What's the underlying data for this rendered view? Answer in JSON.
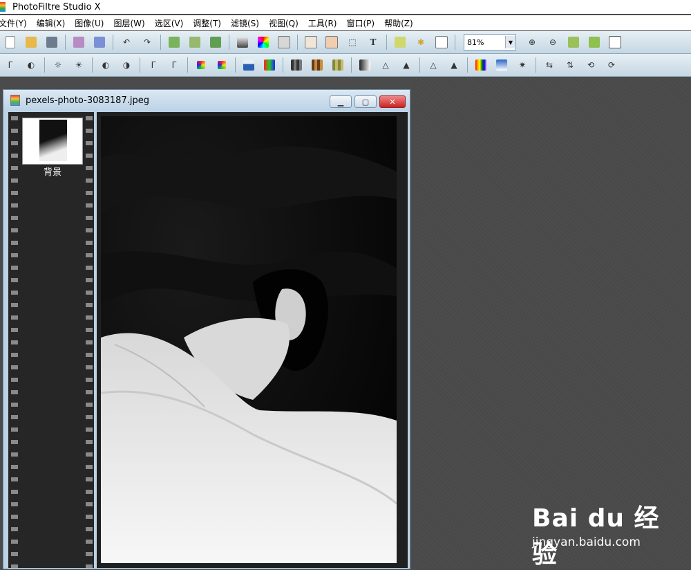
{
  "app": {
    "title": "PhotoFiltre Studio X"
  },
  "menu": [
    {
      "label": "文件(Y)"
    },
    {
      "label": "编辑(X)"
    },
    {
      "label": "图像(U)"
    },
    {
      "label": "图层(W)"
    },
    {
      "label": "选区(V)"
    },
    {
      "label": "调整(T)"
    },
    {
      "label": "滤镜(S)"
    },
    {
      "label": "视图(Q)"
    },
    {
      "label": "工具(R)"
    },
    {
      "label": "窗口(P)"
    },
    {
      "label": "帮助(Z)"
    }
  ],
  "toolbar": {
    "zoom": "81%"
  },
  "document": {
    "title": "pexels-photo-3083187.jpeg"
  },
  "layers": [
    {
      "label": "背景"
    }
  ],
  "watermark": {
    "brand": "Bai du 经验",
    "url": "jingyan.baidu.com"
  }
}
